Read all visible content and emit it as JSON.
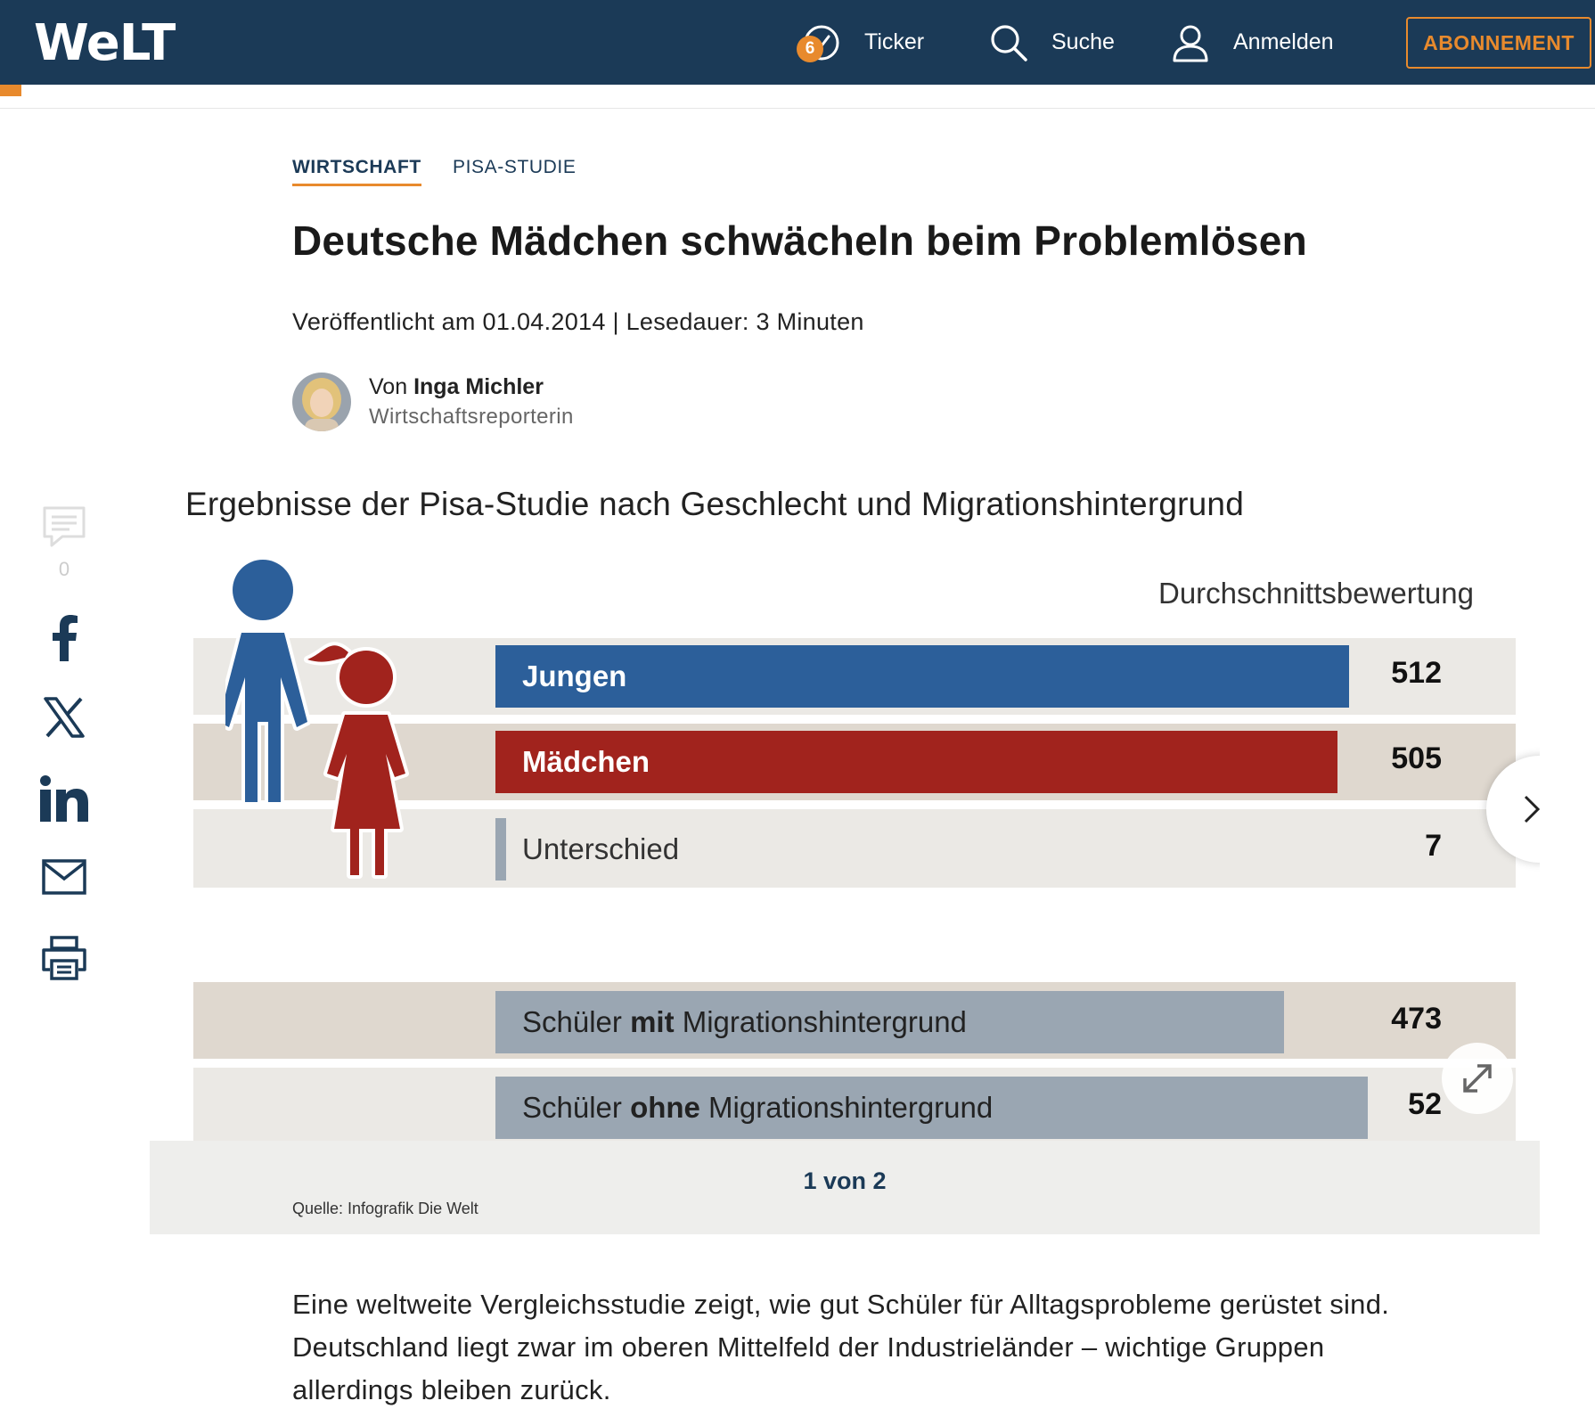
{
  "header": {
    "logo": "WeLT",
    "ticker_badge": "6",
    "ticker_label": "Ticker",
    "search_label": "Suche",
    "login_label": "Anmelden",
    "subscribe_label": "ABONNEMENT"
  },
  "breadcrumbs": [
    "WIRTSCHAFT",
    "PISA-STUDIE"
  ],
  "article": {
    "headline": "Deutsche Mädchen schwächeln beim Problemlösen",
    "meta": "Veröffentlicht am 01.04.2014 | Lesedauer: 3 Minuten",
    "author_prefix": "Von ",
    "author_name": "Inga Michler",
    "author_role": "Wirtschaftsreporterin",
    "lead": "Eine weltweite Vergleichsstudie zeigt, wie gut Schüler für Alltagsprobleme gerüstet sind. Deutschland liegt zwar im oberen Mittelfeld der Industrieländer – wichtige Gruppen allerdings bleiben zurück."
  },
  "share": {
    "comment_count": "0"
  },
  "gallery": {
    "counter": "1 von 2",
    "source": "Quelle: Infografik Die Welt"
  },
  "chart_data": {
    "type": "bar",
    "orientation": "horizontal",
    "title": "Ergebnisse der Pisa-Studie nach Geschlecht und Migrationshintergrund",
    "unit_label": "Durchschnittsbewertung",
    "categories": [
      "Jungen",
      "Mädchen",
      "Unterschied",
      "Schüler mit Migrationshintergrund",
      "Schüler ohne Migrationshintergrund"
    ],
    "values": [
      512,
      505,
      7,
      473,
      523
    ],
    "value_labels": [
      "512",
      "505",
      "7",
      "473",
      "52"
    ],
    "label_parts": {
      "mit": [
        "Schüler ",
        "mit",
        " Migrationshintergrund"
      ],
      "ohne": [
        "Schüler ",
        "ohne",
        " Migrationshintergrund"
      ]
    },
    "colors": {
      "Jungen": "#2c5f9a",
      "Mädchen": "#a1231d",
      "Unterschied": "#9aa6b2",
      "Migration": "#9aa6b2"
    }
  }
}
